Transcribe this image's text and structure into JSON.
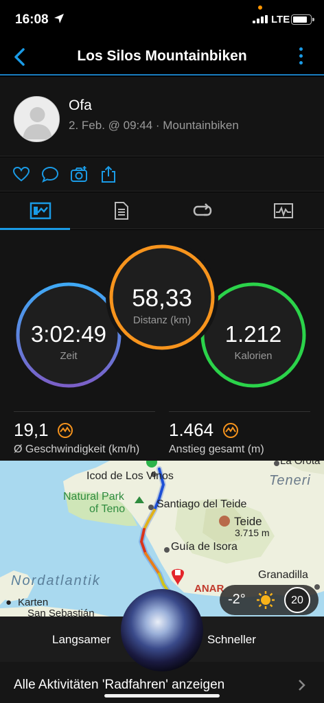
{
  "status_bar": {
    "time": "16:08",
    "network": "LTE"
  },
  "nav": {
    "title": "Los Silos Mountainbiken"
  },
  "profile": {
    "name": "Ofa",
    "meta": "2. Feb. @ 09:44 · Mountainbiken"
  },
  "stats": {
    "distance": {
      "value": "58,33",
      "label": "Distanz (km)"
    },
    "time": {
      "value": "3:02:49",
      "label": "Zeit"
    },
    "calories": {
      "value": "1.212",
      "label": "Kalorien"
    },
    "avg_speed": {
      "value": "19,1",
      "label": "Ø Geschwindigkeit (km/h)"
    },
    "ascent": {
      "value": "1.464",
      "label": "Anstieg gesamt (m)"
    }
  },
  "map": {
    "labels": {
      "icod": "Icod de Los Vinos",
      "natural_park": "Natural Park",
      "of_teno": "of Teno",
      "santiago": "Santiago del Teide",
      "teide": "Teide",
      "teide_height": "3.715 m",
      "guia": "Guía de Isora",
      "nordatlantik": "Nordatlantik",
      "granadilla": "Granadilla",
      "tenerife": "Teneri",
      "la_orotava": "La Orota",
      "karten": "Karten",
      "san_sebastian": "San Sebastián",
      "anar": "ANAR"
    },
    "weather": {
      "temp": "-2°",
      "aqi": "20"
    }
  },
  "bottom": {
    "slower": "Langsamer",
    "faster": "Schneller",
    "all_activities": "Alle Aktivitäten 'Radfahren' anzeigen"
  },
  "colors": {
    "accent": "#1a9be6",
    "distance_ring": "#f7941d",
    "time_ring_top": "#3fa9f5",
    "time_ring_bottom": "#7b5fc7",
    "calories_ring": "#2bd34a",
    "ascent_icon": "#f7941d"
  }
}
